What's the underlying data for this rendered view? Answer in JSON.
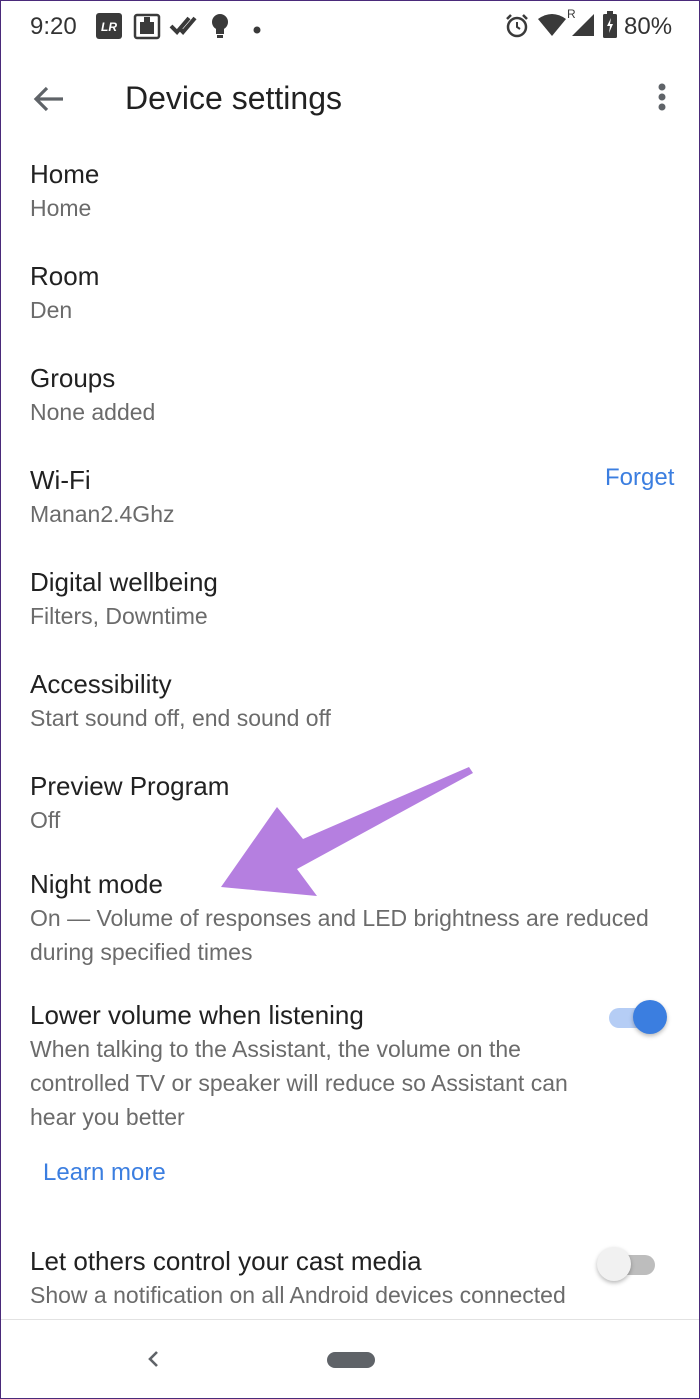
{
  "status_bar": {
    "time": "9:20",
    "battery_percent": "80%",
    "left_icons": [
      "lr-icon",
      "app-icon",
      "double-check-icon",
      "bulb-icon",
      "dot-icon"
    ],
    "right_icons": [
      "alarm-icon",
      "wifi-icon",
      "signal-icon",
      "battery-icon"
    ],
    "signal_roaming_label": "R"
  },
  "app_bar": {
    "title": "Device settings",
    "back_icon": "arrow-left-icon",
    "more_icon": "more-vertical-icon"
  },
  "settings": {
    "home": {
      "title": "Home",
      "subtitle": "Home"
    },
    "room": {
      "title": "Room",
      "subtitle": "Den"
    },
    "groups": {
      "title": "Groups",
      "subtitle": "None added"
    },
    "wifi": {
      "title": "Wi-Fi",
      "subtitle": "Manan2.4Ghz",
      "action": "Forget"
    },
    "wellbeing": {
      "title": "Digital wellbeing",
      "subtitle": "Filters, Downtime"
    },
    "accessibility": {
      "title": "Accessibility",
      "subtitle": "Start sound off, end sound off"
    },
    "preview": {
      "title": "Preview Program",
      "subtitle": "Off"
    },
    "night_mode": {
      "title": "Night mode",
      "subtitle_line1": "On — Volume of responses and LED brightness are reduced",
      "subtitle_line2": "during specified times"
    },
    "lower_volume": {
      "title": "Lower volume when listening",
      "subtitle_line1": "When talking to the Assistant, the volume on the",
      "subtitle_line2": "controlled TV or speaker will reduce so Assistant can",
      "subtitle_line3": "hear you better",
      "enabled": true,
      "learn_more": "Learn more"
    },
    "cast_control": {
      "title": "Let others control your cast media",
      "subtitle": "Show a notification on all Android devices connected",
      "enabled": false
    }
  },
  "annotation": {
    "type": "arrow",
    "color": "#b57fe0",
    "points_to": "Night mode"
  },
  "colors": {
    "accent": "#3b7ee0",
    "toggle_on_thumb": "#3b7ee0",
    "toggle_on_track": "#b5cdf5",
    "toggle_off_thumb": "#f1f1f1",
    "toggle_off_track": "#bdbdbd",
    "subtitle": "#6b6b6b"
  },
  "nav_bar": {
    "back_icon": "nav-back-icon",
    "home_icon": "nav-home-pill-icon"
  }
}
